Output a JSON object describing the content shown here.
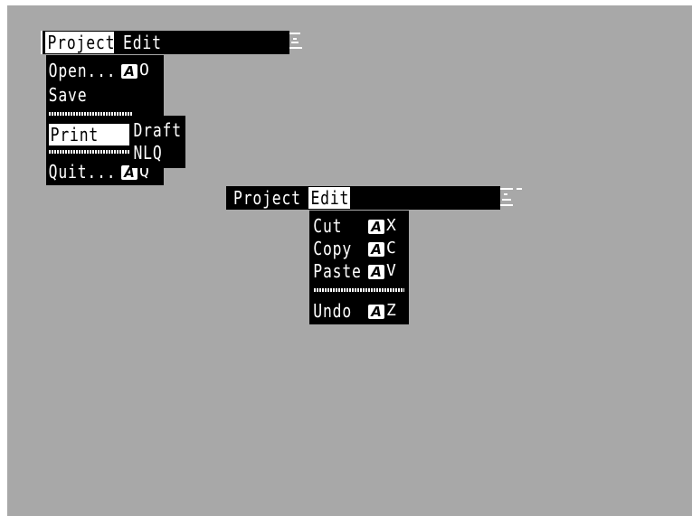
{
  "menubar1": {
    "titles": [
      "Project",
      "Edit"
    ],
    "project_menu": {
      "open": {
        "label": "Open...",
        "shortcut_icon": "amiga-key-icon",
        "shortcut_key": "O"
      },
      "save": {
        "label": "Save"
      },
      "print": {
        "label": "Print"
      },
      "quit": {
        "label": "Quit...",
        "shortcut_icon": "amiga-key-icon",
        "shortcut_key": "Q"
      }
    },
    "print_submenu": [
      "Draft",
      "NLQ"
    ]
  },
  "menubar2": {
    "titles": [
      "Project",
      "Edit"
    ],
    "edit_menu": {
      "items": [
        {
          "label": "Cut",
          "shortcut_icon": "amiga-key-icon",
          "shortcut_key": "X"
        },
        {
          "label": "Copy",
          "shortcut_icon": "amiga-key-icon",
          "shortcut_key": "C"
        },
        {
          "label": "Paste",
          "shortcut_icon": "amiga-key-icon",
          "shortcut_key": "V"
        },
        {
          "label": "Undo",
          "shortcut_icon": "amiga-key-icon",
          "shortcut_key": "Z"
        }
      ]
    }
  },
  "amiga_key_glyph": "A",
  "colors": {
    "background": "#a8a8a8",
    "menu": "#000000",
    "text": "#ffffff",
    "highlight": "#ffffff"
  }
}
